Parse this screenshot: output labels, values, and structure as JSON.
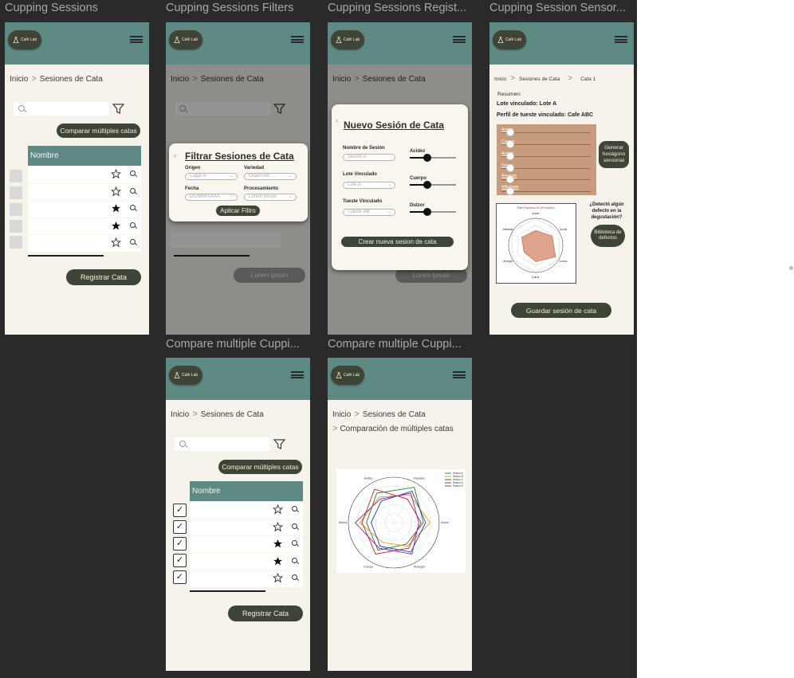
{
  "app": {
    "logo_text": "Café Lab",
    "breadcrumb_home": "Inicio",
    "breadcrumb_sep": ">",
    "breadcrumb_section": "Sesiones de Cata"
  },
  "frames": {
    "f1": {
      "title": "Cupping Sessions",
      "compare_button": "Comparar múltiples catas",
      "table_header": "Nombre",
      "rows": [
        {
          "favorite": false
        },
        {
          "favorite": false
        },
        {
          "favorite": true
        },
        {
          "favorite": true
        },
        {
          "favorite": false
        }
      ],
      "register_button": "Registrar Cata"
    },
    "f2": {
      "title": "Cupping Sessions Filters",
      "modal_title": "Filtrar Sesiones de Cata",
      "origen_label": "Origen",
      "origen_value": "Lugar A",
      "variedad_label": "Variedad",
      "variedad_value": "Grano AB",
      "fecha_label": "Fecha",
      "fecha_value": "DD/MM/AAAA",
      "procesamiento_label": "Procesamiento",
      "procesamiento_value": "Lorem Ipsum",
      "apply_button": "Aplicar Filtro",
      "bg_button": "Lorem Ipsum"
    },
    "f3": {
      "title": "Cupping Sessions Regist...",
      "modal_title": "Nuevo Sesión de Cata",
      "nombre_label": "Nombre de Sesión",
      "nombre_value": "Sesion A",
      "lote_label": "Lote Vinculado",
      "lote_value": "Lote A",
      "tueste_label": "Tueste Vinculado",
      "tueste_value": "Tueste AB",
      "sliders": [
        {
          "label": "Acidez",
          "level": 0.38
        },
        {
          "label": "Cuerpo",
          "level": 0.38
        },
        {
          "label": "Dulzor",
          "level": 0.38
        }
      ],
      "create_button": "Crear nueva sesion de cata",
      "bg_button": "Lorem Ipsum"
    },
    "f4": {
      "title": "Cupping Session Sensor...",
      "breadcrumb_extra": "Cata 1",
      "summary_label": "Resumen:",
      "lote_text": "Lote vinculado:  Lote A",
      "perfil_text": "Perfil de tueste vinculado: Cafe ABC",
      "attributes": [
        {
          "label": "Aroma",
          "level": 0.1
        },
        {
          "label": "Cuerpo",
          "level": 0.1
        },
        {
          "label": "Acidez",
          "level": 0.1
        },
        {
          "label": "Dulzor",
          "level": 0.1
        },
        {
          "label": "Amargor",
          "level": 0.1
        },
        {
          "label": "Aftertaste",
          "level": 0.1
        }
      ],
      "generate_button": "Generar hexágono sensorial",
      "defect_question": "¿Detectó algún defecto en la degustación?",
      "library_button": "Biblioteca de defectos",
      "save_button": "Guardar sesión de cata",
      "radar_title": "Cafe Espresso #1 (Promedio)",
      "radar_labels": [
        "Acidez",
        "Aroma",
        "Cuerpo",
        "Dulzor",
        "Amargor",
        "Aftertaste"
      ]
    },
    "f5": {
      "title": "Compare multiple Cuppi...",
      "compare_button": "Comparar múltiples catas",
      "table_header": "Nombre",
      "rows": [
        {
          "favorite": false,
          "checked": true
        },
        {
          "favorite": false,
          "checked": true
        },
        {
          "favorite": true,
          "checked": true
        },
        {
          "favorite": true,
          "checked": true
        },
        {
          "favorite": false,
          "checked": true
        }
      ],
      "check_mark": "✓",
      "register_button": "Registrar Cata"
    },
    "f6": {
      "title": "Compare multiple Cuppi...",
      "subtitle": "Comparación de múltiples catas",
      "radar_labels": [
        "Acidez",
        "Residuo",
        "Dulzor",
        "Amargor",
        "Cuerpo",
        "Aroma"
      ],
      "legend": [
        "Sesión A",
        "Sesión B",
        "Sesión C",
        "Sesión D",
        "Sesión E"
      ],
      "series_colors": [
        "#2e7d32",
        "#e6a100",
        "#1e3fbf",
        "#c41e3a",
        "#8e24aa"
      ]
    }
  }
}
